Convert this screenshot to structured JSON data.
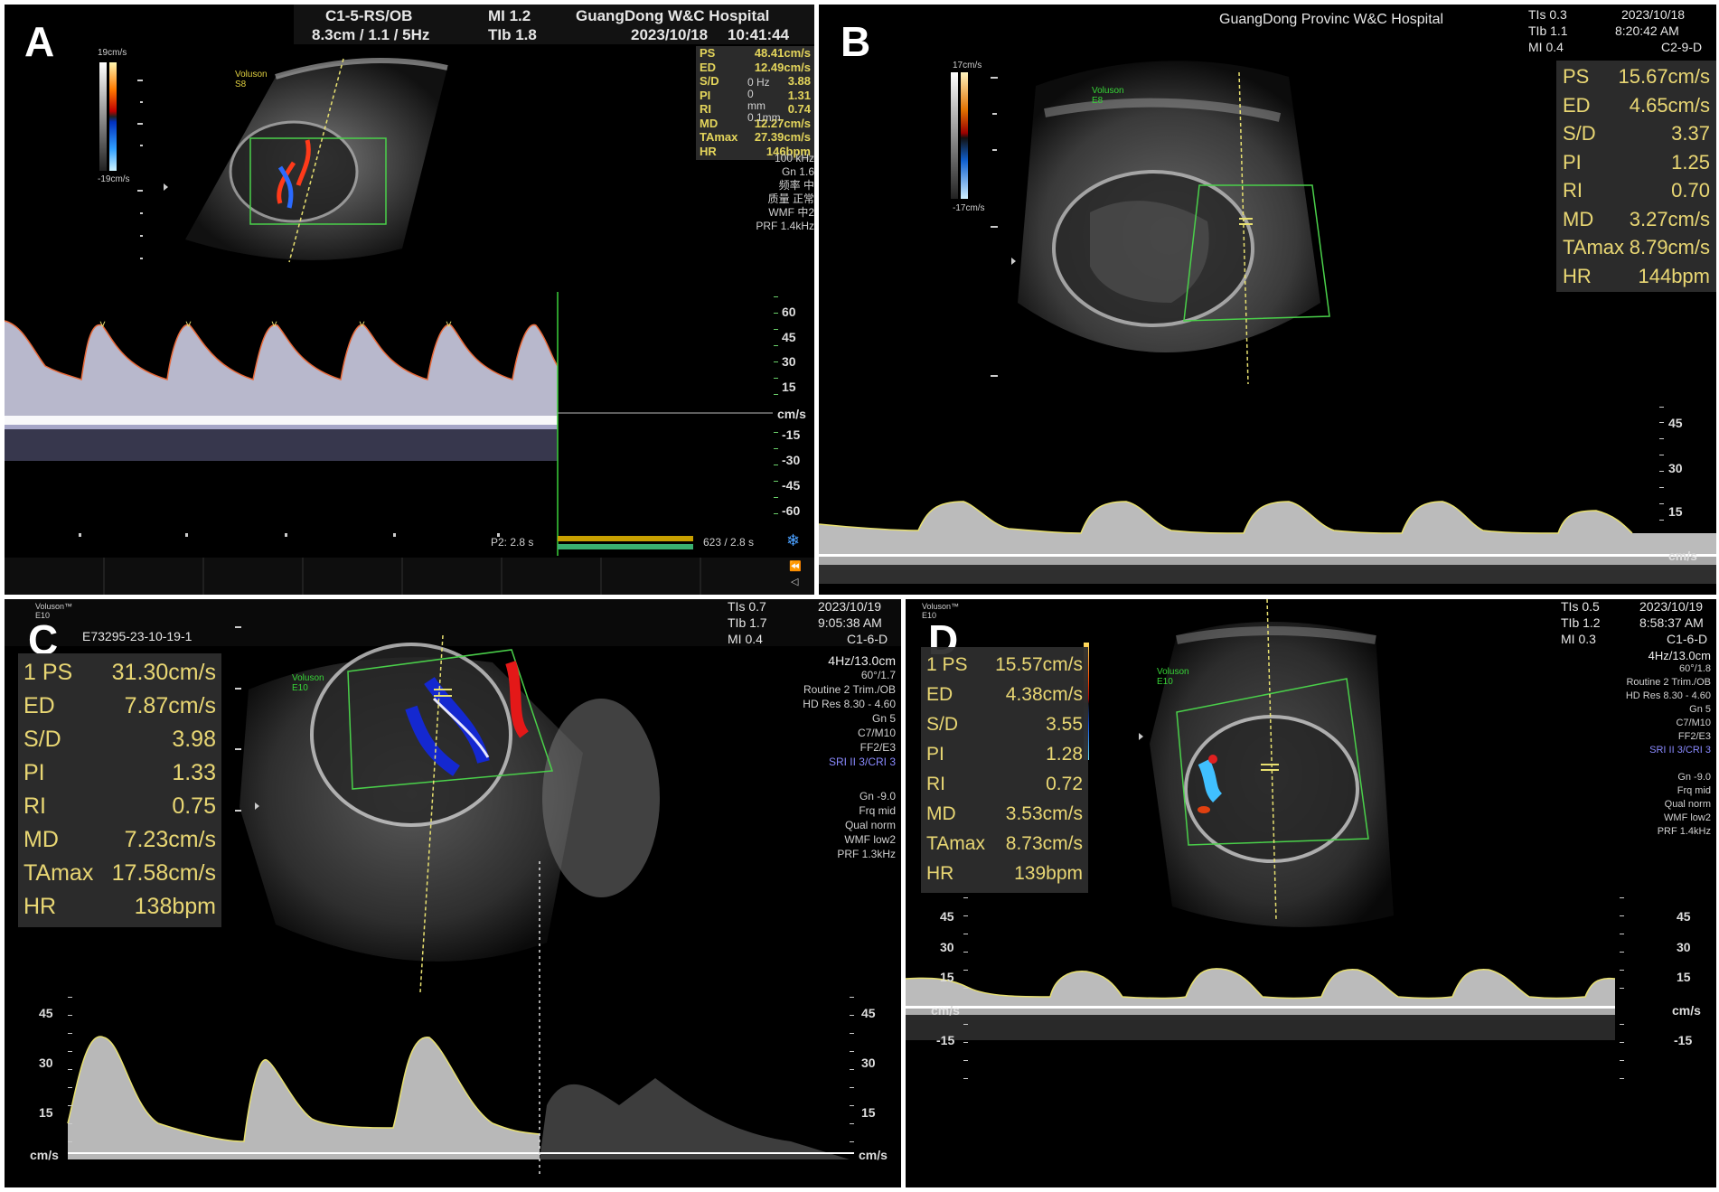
{
  "figure": {
    "panels": [
      {
        "letter": "A",
        "header": {
          "probe": "C1-5-RS/OB",
          "mi": "MI  1.2",
          "hospital": "GuangDong W&C Hospital",
          "depth": "8.3cm / 1.1 / 5Hz",
          "tib": "TIb  1.8",
          "date": "2023/10/18",
          "time": "10:41:44"
        },
        "brand": "Voluson\nS8",
        "color_bar_top": "19cm/s",
        "color_bar_bottom": "-19cm/s",
        "measurements": [
          {
            "label": "PS",
            "value": "48.41cm/s"
          },
          {
            "label": "ED",
            "value": "12.49cm/s"
          },
          {
            "label": "S/D",
            "value": "3.88"
          },
          {
            "label": "PI",
            "value": "1.31"
          },
          {
            "label": "RI",
            "value": "0.74"
          },
          {
            "label": "MD",
            "value": "12.27cm/s"
          },
          {
            "label": "TAmax",
            "value": "27.39cm/s"
          },
          {
            "label": "HR",
            "value": "146bpm"
          }
        ],
        "params": [
          "0 Hz",
          "0",
          "mm",
          "0.1mm",
          "100 kHz",
          "Gn  1.6",
          "频率  中",
          "质量  正常",
          "WMF  中2",
          "PRF  1.4kHz"
        ],
        "scale_ticks": [
          "60",
          "45",
          "30",
          "15",
          "cm/s",
          "-15",
          "-30",
          "-45",
          "-60"
        ],
        "footer_left": "P2:   2.8 s",
        "footer_right": "623 / 2.8 s"
      },
      {
        "letter": "B",
        "header": {
          "hospital": "GuangDong Provinc W&C Hospital",
          "tis": "TIs   0.3",
          "tib": "TIb   1.1",
          "mi": "MI   0.4",
          "date": "2023/10/18",
          "time": "8:20:42 AM",
          "probe": "C2-9-D"
        },
        "brand": "Voluson\nE8",
        "color_bar_top": "17cm/s",
        "color_bar_bottom": "-17cm/s",
        "measurements": [
          {
            "label": "PS",
            "value": "15.67cm/s"
          },
          {
            "label": "ED",
            "value": "4.65cm/s"
          },
          {
            "label": "S/D",
            "value": "3.37"
          },
          {
            "label": "PI",
            "value": "1.25"
          },
          {
            "label": "RI",
            "value": "0.70"
          },
          {
            "label": "MD",
            "value": "3.27cm/s"
          },
          {
            "label": "TAmax",
            "value": "8.79cm/s"
          },
          {
            "label": "HR",
            "value": "144bpm"
          }
        ],
        "scale_ticks": [
          "45",
          "30",
          "15",
          "cm/s"
        ]
      },
      {
        "letter": "C",
        "header": {
          "brand_top": "Voluson™\nE10",
          "patient": "E73295-23-10-19-1",
          "tis": "TIs   0.7",
          "tib": "TIb   1.7",
          "mi": "MI   0.4",
          "date": "2023/10/19",
          "time": "9:05:38 AM",
          "probe": "C1-6-D"
        },
        "brand": "Voluson\nE10",
        "measurements": [
          {
            "label": "1 PS",
            "value": "31.30cm/s"
          },
          {
            "label": "ED",
            "value": "7.87cm/s"
          },
          {
            "label": "S/D",
            "value": "3.98"
          },
          {
            "label": "PI",
            "value": "1.33"
          },
          {
            "label": "RI",
            "value": "0.75"
          },
          {
            "label": "MD",
            "value": "7.23cm/s"
          },
          {
            "label": "TAmax",
            "value": "17.58cm/s"
          },
          {
            "label": "HR",
            "value": "138bpm"
          }
        ],
        "params_top": [
          "4Hz/13.0cm",
          "60°/1.7",
          "Routine 2 Trim./OB",
          "HD Res 8.30 - 4.60",
          "Gn  5",
          "C7/M10",
          "FF2/E3"
        ],
        "params_blue": "SRI II 3/CRI 3",
        "params_bottom": [
          "Gn -9.0",
          "Frq mid",
          "Qual norm",
          "WMF low2",
          "PRF  1.3kHz"
        ],
        "scale_ticks": [
          "45",
          "30",
          "15",
          "cm/s"
        ]
      },
      {
        "letter": "D",
        "header": {
          "brand_top": "Voluson™\nE10",
          "tis": "TIs   0.5",
          "tib": "TIb   1.2",
          "mi": "MI   0.3",
          "date": "2023/10/19",
          "time": "8:58:37 AM",
          "probe": "C1-6-D"
        },
        "brand": "Voluson\nE10",
        "measurements": [
          {
            "label": "1 PS",
            "value": "15.57cm/s"
          },
          {
            "label": "ED",
            "value": "4.38cm/s"
          },
          {
            "label": "S/D",
            "value": "3.55"
          },
          {
            "label": "PI",
            "value": "1.28"
          },
          {
            "label": "RI",
            "value": "0.72"
          },
          {
            "label": "MD",
            "value": "3.53cm/s"
          },
          {
            "label": "TAmax",
            "value": "8.73cm/s"
          },
          {
            "label": "HR",
            "value": "139bpm"
          }
        ],
        "params_top": [
          "4Hz/13.0cm",
          "60°/1.8",
          "Routine 2 Trim./OB",
          "HD Res 8.30 - 4.60",
          "Gn  5",
          "C7/M10",
          "FF2/E3"
        ],
        "params_blue": "SRI II 3/CRI 3",
        "params_bottom": [
          "Gn -9.0",
          "Frq mid",
          "Qual norm",
          "WMF low2",
          "PRF  1.4kHz"
        ],
        "scale_ticks": [
          "45",
          "30",
          "15",
          "cm/s",
          "-15"
        ]
      }
    ]
  }
}
